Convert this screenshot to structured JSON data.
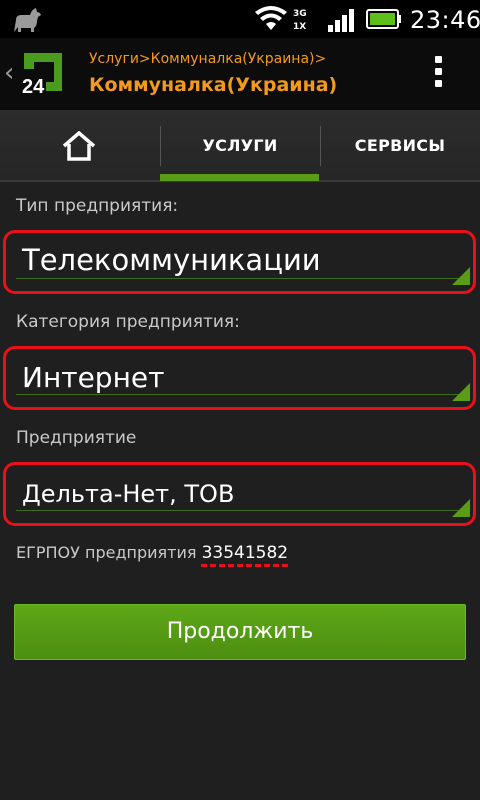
{
  "status_bar": {
    "network_line1": "3G",
    "network_line2": "1X",
    "time": "23:46",
    "icons": [
      "android-creature-icon",
      "wifi-icon",
      "network-type-icon",
      "signal-icon",
      "battery-icon"
    ]
  },
  "action_bar": {
    "logo_text": "24",
    "breadcrumb": "Услуги>Коммуналка(Украина)>",
    "title": "Коммуналка(Украина)",
    "accent_color": "#f39a1e"
  },
  "tabs": {
    "home_icon": "home-icon",
    "services_label": "УСЛУГИ",
    "tools_label": "СЕРВИСЫ",
    "active": "services",
    "indicator_color": "#5a9c16"
  },
  "form": {
    "enterprise_type": {
      "label": "Тип предприятия:",
      "value": "Телекоммуникации"
    },
    "enterprise_category": {
      "label": "Категория предприятия:",
      "value": "Интернет"
    },
    "enterprise": {
      "label": "Предприятие",
      "value": "Дельта-Нет, ТОВ"
    },
    "egrpou_label": "ЕГРПОУ предприятия",
    "egrpou_code": "33541582",
    "highlight_color": "#e8111a"
  },
  "continue_label": "Продолжить"
}
